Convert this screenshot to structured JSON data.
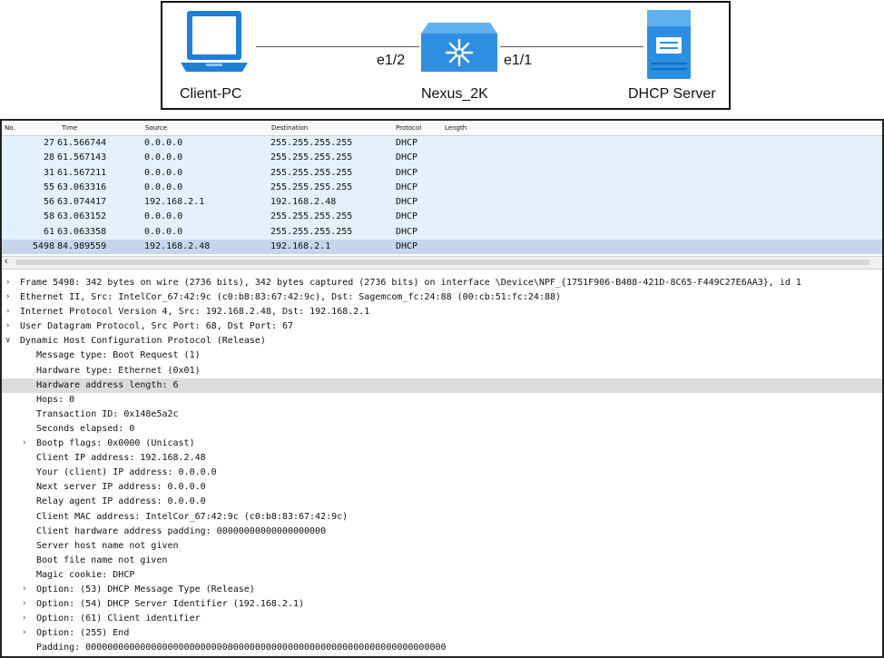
{
  "topology": {
    "client_label": "Client-PC",
    "switch_label": "Nexus_2K",
    "server_label": "DHCP Server",
    "port_left": "e1/2",
    "port_right": "e1/1"
  },
  "packet_list": {
    "columns": [
      "No.",
      "Time",
      "Source",
      "Destination",
      "Protocol",
      "Length"
    ],
    "rows": [
      {
        "no": "27",
        "time": "61.566744",
        "source": "0.0.0.0",
        "destination": "255.255.255.255",
        "protocol": "DHCP"
      },
      {
        "no": "28",
        "time": "61.567143",
        "source": "0.0.0.0",
        "destination": "255.255.255.255",
        "protocol": "DHCP"
      },
      {
        "no": "31",
        "time": "61.567211",
        "source": "0.0.0.0",
        "destination": "255.255.255.255",
        "protocol": "DHCP"
      },
      {
        "no": "55",
        "time": "63.063316",
        "source": "0.0.0.0",
        "destination": "255.255.255.255",
        "protocol": "DHCP"
      },
      {
        "no": "56",
        "time": "63.074417",
        "source": "192.168.2.1",
        "destination": "192.168.2.48",
        "protocol": "DHCP"
      },
      {
        "no": "58",
        "time": "63.063152",
        "source": "0.0.0.0",
        "destination": "255.255.255.255",
        "protocol": "DHCP"
      },
      {
        "no": "61",
        "time": "63.063358",
        "source": "0.0.0.0",
        "destination": "255.255.255.255",
        "protocol": "DHCP"
      },
      {
        "no": "5498",
        "time": "84.989559",
        "source": "192.168.2.48",
        "destination": "192.168.2.1",
        "protocol": "DHCP",
        "selected": true
      }
    ]
  },
  "packet_detail": {
    "lines": [
      {
        "text": "Frame 5498: 342 bytes on wire (2736 bits), 342 bytes captured (2736 bits) on interface \\Device\\NPF_{1751F906-B488-421D-8C65-F449C27E6AA3}, id 1",
        "expander": "collapsed",
        "indent": 0
      },
      {
        "text": "Ethernet II, Src: IntelCor_67:42:9c (c0:b8:83:67:42:9c), Dst: Sagemcom_fc:24:88 (00:cb:51:fc:24:88)",
        "expander": "collapsed",
        "indent": 0
      },
      {
        "text": "Internet Protocol Version 4, Src: 192.168.2.48, Dst: 192.168.2.1",
        "expander": "collapsed",
        "indent": 0
      },
      {
        "text": "User Datagram Protocol, Src Port: 68, Dst Port: 67",
        "expander": "collapsed",
        "indent": 0
      },
      {
        "text": "Dynamic Host Configuration Protocol (Release)",
        "expander": "expanded",
        "indent": 0
      },
      {
        "text": "Message type: Boot Request (1)",
        "expander": "none",
        "indent": 1
      },
      {
        "text": "Hardware type: Ethernet (0x01)",
        "expander": "none",
        "indent": 1
      },
      {
        "text": "Hardware address length: 6",
        "expander": "none",
        "indent": 1,
        "highlight": true
      },
      {
        "text": "Hops: 0",
        "expander": "none",
        "indent": 1
      },
      {
        "text": "Transaction ID: 0x148e5a2c",
        "expander": "none",
        "indent": 1
      },
      {
        "text": "Seconds elapsed: 0",
        "expander": "none",
        "indent": 1
      },
      {
        "text": "Bootp flags: 0x0000 (Unicast)",
        "expander": "collapsed",
        "indent": 1
      },
      {
        "text": "Client IP address: 192.168.2.48",
        "expander": "none",
        "indent": 1
      },
      {
        "text": "Your (client) IP address: 0.0.0.0",
        "expander": "none",
        "indent": 1
      },
      {
        "text": "Next server IP address: 0.0.0.0",
        "expander": "none",
        "indent": 1
      },
      {
        "text": "Relay agent IP address: 0.0.0.0",
        "expander": "none",
        "indent": 1
      },
      {
        "text": "Client MAC address: IntelCor_67:42:9c (c0:b8:83:67:42:9c)",
        "expander": "none",
        "indent": 1
      },
      {
        "text": "Client hardware address padding: 00000000000000000000",
        "expander": "none",
        "indent": 1
      },
      {
        "text": "Server host name not given",
        "expander": "none",
        "indent": 1
      },
      {
        "text": "Boot file name not given",
        "expander": "none",
        "indent": 1
      },
      {
        "text": "Magic cookie: DHCP",
        "expander": "none",
        "indent": 1
      },
      {
        "text": "Option: (53) DHCP Message Type (Release)",
        "expander": "collapsed",
        "indent": 1
      },
      {
        "text": "Option: (54) DHCP Server Identifier (192.168.2.1)",
        "expander": "collapsed",
        "indent": 1
      },
      {
        "text": "Option: (61) Client identifier",
        "expander": "collapsed",
        "indent": 1
      },
      {
        "text": "Option: (255) End",
        "expander": "collapsed",
        "indent": 1
      },
      {
        "text": "Padding: 000000000000000000000000000000000000000000000000000000000000000000",
        "expander": "none",
        "indent": 1
      }
    ]
  },
  "icons": {
    "client": "laptop-icon",
    "switch": "switch-icon",
    "server": "server-icon",
    "collapsed": "triangle-right-icon",
    "expanded": "triangle-down-icon"
  },
  "colors": {
    "row_bg": "#e2f1fb",
    "selected_row_bg": "#c5d7ec",
    "highlight_bg": "#dcdcdc",
    "laptop_blue": "#1e7fd4",
    "switch_blue": "#2f8ee2",
    "server_blue": "#2b8ee3"
  }
}
